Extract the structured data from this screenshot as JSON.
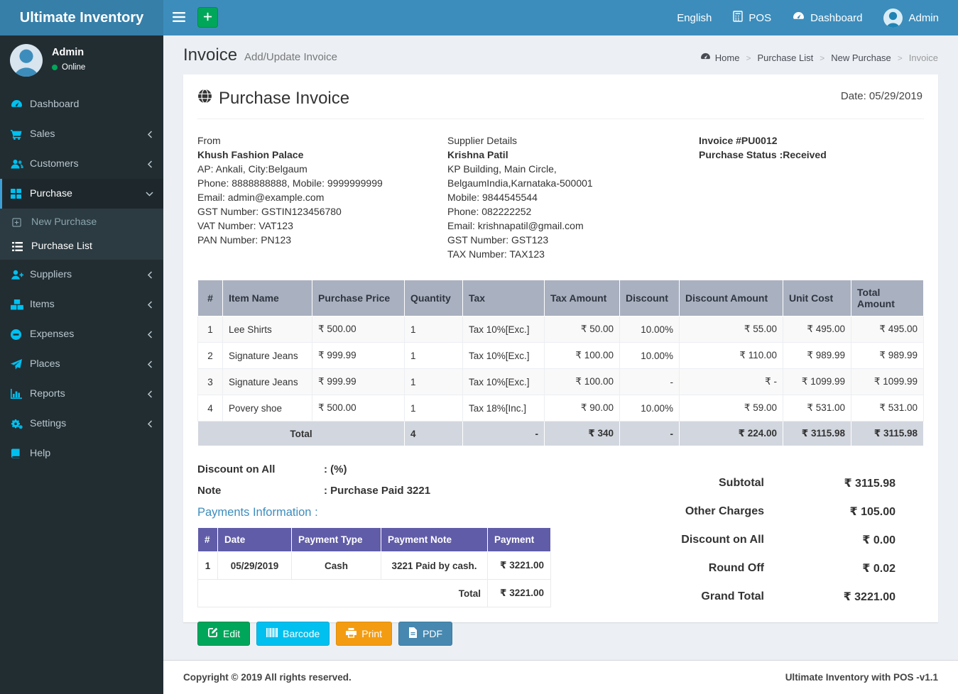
{
  "navbar": {
    "brand": "Ultimate Inventory",
    "language": "English",
    "pos": "POS",
    "dashboard": "Dashboard",
    "user": "Admin"
  },
  "user_panel": {
    "name": "Admin",
    "status": "Online"
  },
  "sidebar": {
    "items": [
      {
        "label": "Dashboard"
      },
      {
        "label": "Sales"
      },
      {
        "label": "Customers"
      },
      {
        "label": "Purchase",
        "children": [
          {
            "label": "New Purchase"
          },
          {
            "label": "Purchase List"
          }
        ]
      },
      {
        "label": "Suppliers"
      },
      {
        "label": "Items"
      },
      {
        "label": "Expenses"
      },
      {
        "label": "Places"
      },
      {
        "label": "Reports"
      },
      {
        "label": "Settings"
      },
      {
        "label": "Help"
      }
    ]
  },
  "page_header": {
    "title": "Invoice",
    "subtitle": "Add/Update Invoice"
  },
  "breadcrumb": {
    "items": [
      "Home",
      "Purchase List",
      "New Purchase",
      "Invoice"
    ]
  },
  "invoice": {
    "title": "Purchase Invoice",
    "date": "Date: 05/29/2019",
    "from": {
      "heading": "From",
      "name": "Khush Fashion Palace",
      "lines": [
        "AP: Ankali, City:Belgaum",
        "Phone: 8888888888, Mobile: 9999999999",
        "Email: admin@example.com",
        "GST Number: GSTIN123456780",
        "VAT Number: VAT123",
        "PAN Number: PN123"
      ]
    },
    "supplier": {
      "heading": "Supplier Details",
      "name": "Krishna Patil",
      "lines": [
        "KP Building, Main Circle, BelgaumIndia,Karnataka-500001",
        "Mobile: 9844545544",
        "Phone: 082222252",
        "Email: krishnapatil@gmail.com",
        "GST Number: GST123",
        "TAX Number: TAX123"
      ]
    },
    "meta": {
      "number": "Invoice #PU0012",
      "status": "Purchase Status :Received"
    }
  },
  "items_table": {
    "headers": [
      "#",
      "Item Name",
      "Purchase Price",
      "Quantity",
      "Tax",
      "Tax Amount",
      "Discount",
      "Discount Amount",
      "Unit Cost",
      "Total Amount"
    ],
    "rows": [
      [
        "1",
        "Lee Shirts",
        "₹ 500.00",
        "1",
        "Tax 10%[Exc.]",
        "₹ 50.00",
        "10.00%",
        "₹ 55.00",
        "₹ 495.00",
        "₹ 495.00"
      ],
      [
        "2",
        "Signature Jeans",
        "₹ 999.99",
        "1",
        "Tax 10%[Exc.]",
        "₹ 100.00",
        "10.00%",
        "₹ 110.00",
        "₹ 989.99",
        "₹ 989.99"
      ],
      [
        "3",
        "Signature Jeans",
        "₹ 999.99",
        "1",
        "Tax 10%[Exc.]",
        "₹ 100.00",
        "-",
        "₹ -",
        "₹ 1099.99",
        "₹ 1099.99"
      ],
      [
        "4",
        "Povery shoe",
        "₹ 500.00",
        "1",
        "Tax 18%[Inc.]",
        "₹ 90.00",
        "10.00%",
        "₹ 59.00",
        "₹ 531.00",
        "₹ 531.00"
      ]
    ],
    "total": {
      "label": "Total",
      "quantity": "4",
      "tax": "-",
      "tax_amount": "₹ 340",
      "discount": "-",
      "discount_amount": "₹ 224.00",
      "unit_cost": "₹ 3115.98",
      "total_amount": "₹ 3115.98"
    }
  },
  "notes": {
    "discount_label": "Discount on All",
    "discount_value": ": (%)",
    "note_label": "Note",
    "note_value": ": Purchase Paid 3221"
  },
  "payments": {
    "heading": "Payments Information :",
    "headers": [
      "#",
      "Date",
      "Payment Type",
      "Payment Note",
      "Payment"
    ],
    "rows": [
      [
        "1",
        "05/29/2019",
        "Cash",
        "3221 Paid by cash.",
        "₹ 3221.00"
      ]
    ],
    "total_label": "Total",
    "total_value": "₹ 3221.00"
  },
  "summary": {
    "rows": [
      {
        "label": "Subtotal",
        "value": "₹ 3115.98"
      },
      {
        "label": "Other Charges",
        "value": "₹ 105.00"
      },
      {
        "label": "Discount on All",
        "value": "₹ 0.00"
      },
      {
        "label": "Round Off",
        "value": "₹ 0.02"
      },
      {
        "label": "Grand Total",
        "value": "₹ 3221.00"
      }
    ]
  },
  "actions": [
    {
      "label": "Edit"
    },
    {
      "label": "Barcode"
    },
    {
      "label": "Print"
    },
    {
      "label": "PDF"
    }
  ],
  "footer": {
    "left": "Copyright © 2019 All rights reserved.",
    "right": "Ultimate Inventory with POS -v1.1"
  },
  "colors": {
    "navbar_blue": "#3c8dbc",
    "brand_blue": "#367fa9",
    "sidebar_dark": "#222d32",
    "submenu_dark": "#2c3b41",
    "sidebar_icon_cyan": "#00c0ef",
    "active_border_blue": "#3c9fd8",
    "online_green": "#00a65a",
    "table_header_gray": "#a9b0bf",
    "total_row_gray": "#d2d6de",
    "payments_header_purple": "#605ca8",
    "link_blue": "#3c8dbc",
    "btn_edit_green": "#00a65a",
    "btn_barcode_cyan": "#00c0ef",
    "btn_print_orange": "#f39c12",
    "btn_pdf_blue": "#4788b0",
    "content_bg": "#ecf0f5"
  }
}
